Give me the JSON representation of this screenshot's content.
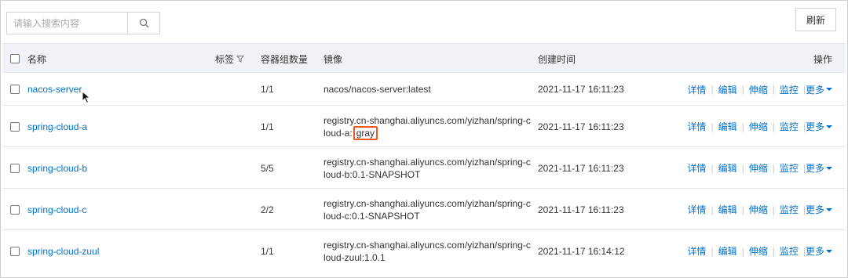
{
  "toolbar": {
    "search_placeholder": "请输入搜索内容",
    "refresh_label": "刷新"
  },
  "table": {
    "headers": {
      "name": "名称",
      "tag": "标签",
      "pods": "容器组数量",
      "image": "镜像",
      "created": "创建时间",
      "operations": "操作"
    },
    "action_labels": {
      "detail": "详情",
      "edit": "编辑",
      "scale": "伸缩",
      "monitor": "监控",
      "more": "更多"
    },
    "rows": [
      {
        "name": "nacos-server",
        "pods": "1/1",
        "image_line1": "nacos/nacos-server:latest",
        "image_line2": "",
        "created": "2021-11-17 16:11:23"
      },
      {
        "name": "spring-cloud-a",
        "pods": "1/1",
        "image_line1": "registry.cn-shanghai.aliyuncs.com/yizhan/spring-c",
        "image_line2_prefix": "loud-a:",
        "image_line2_highlight": "gray",
        "created": "2021-11-17 16:11:23"
      },
      {
        "name": "spring-cloud-b",
        "pods": "5/5",
        "image_line1": "registry.cn-shanghai.aliyuncs.com/yizhan/spring-c",
        "image_line2": "loud-b:0.1-SNAPSHOT",
        "created": "2021-11-17 16:11:23"
      },
      {
        "name": "spring-cloud-c",
        "pods": "2/2",
        "image_line1": "registry.cn-shanghai.aliyuncs.com/yizhan/spring-c",
        "image_line2": "loud-c:0.1-SNAPSHOT",
        "created": "2021-11-17 16:11:23"
      },
      {
        "name": "spring-cloud-zuul",
        "pods": "1/1",
        "image_line1": "registry.cn-shanghai.aliyuncs.com/yizhan/spring-c",
        "image_line2": "loud-zuul:1.0.1",
        "created": "2021-11-17 16:14:12"
      }
    ]
  },
  "colors": {
    "link": "#0070cc",
    "header_bg": "#eff3f8",
    "highlight_border": "#f0561f"
  },
  "icons": [
    "search-icon",
    "filter-icon",
    "caret-down-icon",
    "mouse-cursor-icon"
  ]
}
